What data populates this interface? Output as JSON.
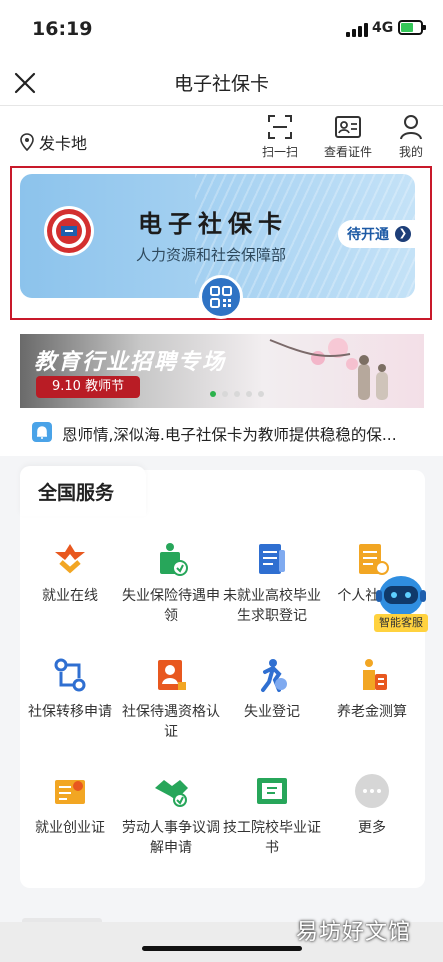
{
  "status_bar": {
    "time": "16:19",
    "network": "4G"
  },
  "nav": {
    "title": "电子社保卡"
  },
  "toolbar": {
    "location": "发卡地",
    "scan_label": "扫一扫",
    "cert_label": "查看证件",
    "mine_label": "我的"
  },
  "card": {
    "title": "电子社保卡",
    "subtitle": "人力资源和社会保障部",
    "action_label": "待开通"
  },
  "banner": {
    "title": "教育行业招聘专场",
    "tag": "9.10 教师节",
    "slide_count": 5,
    "active_slide": 1
  },
  "notice": {
    "text": "恩师情,深似海.电子社保卡为教师提供稳稳的保..."
  },
  "services": {
    "title": "全国服务",
    "items": [
      {
        "label": "就业在线",
        "icon": "employment-icon"
      },
      {
        "label": "失业保险待遇申领",
        "icon": "unemployment-insurance-icon"
      },
      {
        "label": "未就业高校毕业生求职登记",
        "icon": "graduate-registration-icon"
      },
      {
        "label": "个人社保...",
        "icon": "personal-record-icon"
      },
      {
        "label": "社保转移申请",
        "icon": "transfer-icon"
      },
      {
        "label": "社保待遇资格认证",
        "icon": "qualification-icon"
      },
      {
        "label": "失业登记",
        "icon": "unemployment-register-icon"
      },
      {
        "label": "养老金测算",
        "icon": "pension-icon"
      },
      {
        "label": "就业创业证",
        "icon": "entrepreneur-card-icon"
      },
      {
        "label": "劳动人事争议调解申请",
        "icon": "handshake-icon"
      },
      {
        "label": "技工院校毕业证书",
        "icon": "certificate-icon"
      },
      {
        "label": "更多",
        "icon": "more-icon"
      }
    ]
  },
  "assistant": {
    "label": "智能客服"
  },
  "watermark": "易坊好文馆",
  "colors": {
    "accent": "#2f73c4",
    "highlight_frame": "#c8192a",
    "banner_tag": "#b91c25",
    "active_dot": "#2bb24c"
  }
}
